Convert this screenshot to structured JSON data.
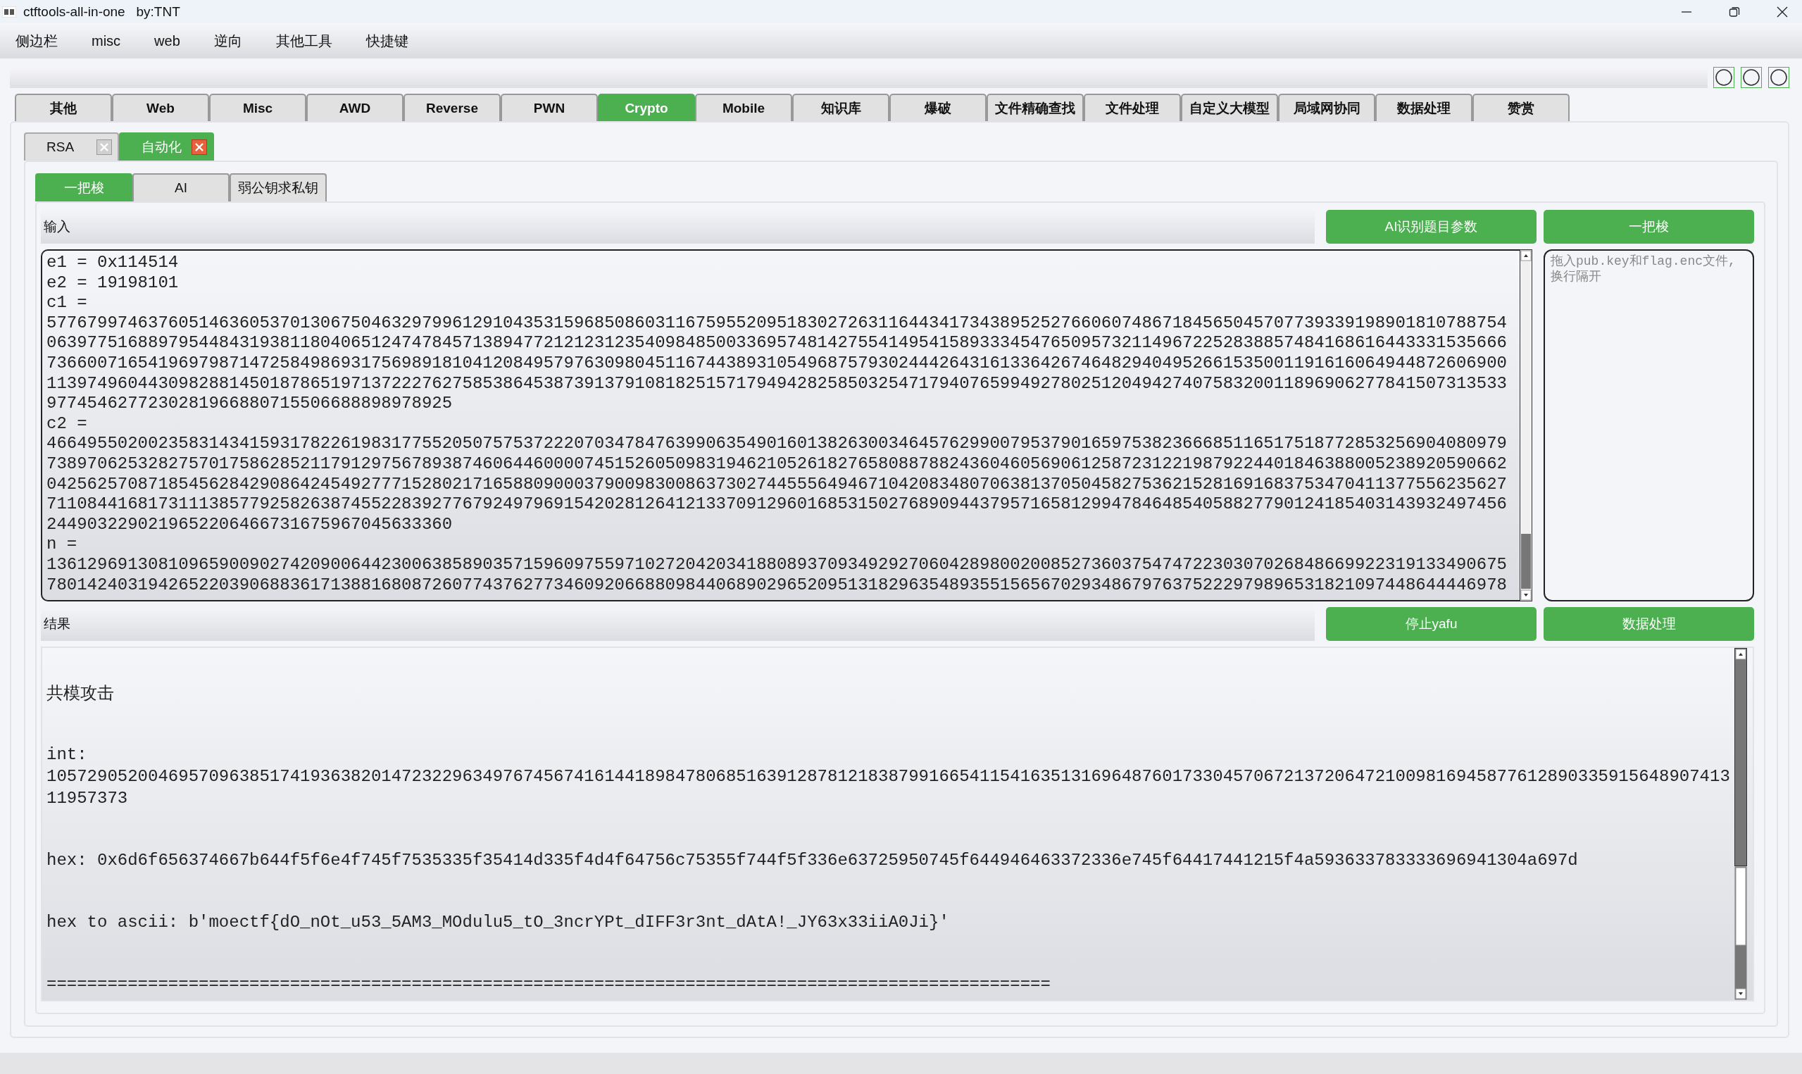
{
  "window": {
    "title": "ctftools-all-in-one   by:TNT"
  },
  "menu": [
    "侧边栏",
    "misc",
    "web",
    "逆向",
    "其他工具",
    "快捷键"
  ],
  "tabs": [
    {
      "label": "其他",
      "selected": false
    },
    {
      "label": "Web",
      "selected": false
    },
    {
      "label": "Misc",
      "selected": false
    },
    {
      "label": "AWD",
      "selected": false
    },
    {
      "label": "Reverse",
      "selected": false
    },
    {
      "label": "PWN",
      "selected": false
    },
    {
      "label": "Crypto",
      "selected": true
    },
    {
      "label": "Mobile",
      "selected": false
    },
    {
      "label": "知识库",
      "selected": false
    },
    {
      "label": "爆破",
      "selected": false
    },
    {
      "label": "文件精确查找",
      "selected": false
    },
    {
      "label": "文件处理",
      "selected": false
    },
    {
      "label": "自定义大模型",
      "selected": false
    },
    {
      "label": "局域网协同",
      "selected": false
    },
    {
      "label": "数据处理",
      "selected": false
    },
    {
      "label": "赞赏",
      "selected": false
    }
  ],
  "subtabs": [
    {
      "label": "RSA",
      "selected": false
    },
    {
      "label": "自动化",
      "selected": true
    }
  ],
  "modes": [
    {
      "label": "一把梭",
      "selected": true
    },
    {
      "label": "AI",
      "selected": false
    },
    {
      "label": "弱公钥求私钥",
      "selected": false
    }
  ],
  "input": {
    "label": "输入",
    "buttons": [
      "AI识别题目参数",
      "一把梭"
    ],
    "lines": [
      "e1 = 0x114514",
      "e2 = 19198101",
      "c1 =",
      "5776799746376051463605370130675046329799612910435315968508603116759552095183027263116443417343895252766060748671845650457077393391989018107887540639775168897954484319381180406512474784571389477212123123540984850033695748142755414954158933345476509573211496722528388574841686164433315356667366007165419697987147258498693175698918104120849579763098045116744389310549687579302444264316133642674648294049526615350011916160649448726069001139749604430982881450187865197137222762758538645387391379108182515717949428258503254717940765994927802512049427407583200118969062778415073135339774546277230281966880715506688898978925",
      "c2 =",
      "4664955020023583143415931782261983177552050757537222070347847639906354901601382630034645762990079537901659753823666851165175187728532569040809797389706253282757017586285211791297567893874606446000074515260509831946210526182765808878824360460569061258723122198792244018463880052389205906620425625708718545628429086424549277715280217165880900037900983008637302744555649467104208348070638137050458275362152816916837534704113775562356277110844168173111385779258263874552283927767924979691542028126412133709129601685315027689094437957165812994784648540588277901241854031439324974562449032290219652206466731675967045633360",
      "n =",
      "136129691308109659009027420900644230063858903571596097559710272042034188089370934929270604289800200852736037547472230307026848669922319133490675780142403194265220390688361713881680872607743762773460920668809844068902965209513182963548935515656702934867976375222979896531821097448644446978"
    ],
    "side_placeholder": "拖入pub.key和flag.enc文件,换行隔开"
  },
  "result": {
    "label": "结果",
    "buttons": [
      "停止yafu",
      "数据处理"
    ],
    "blocks": [
      {
        "kind": "title",
        "text": "共模攻击"
      },
      {
        "kind": "value",
        "label": "int:",
        "text": "105729052004695709638517419363820147232296349767456741614418984780685163912878121838799166541154163513169648760173304570672137206472100981694587761289033591564890741311957373"
      },
      {
        "kind": "inline",
        "text": "hex: 0x6d6f656374667b644f5f6e4f745f7535335f35414d335f4d4f64756c75355f744f5f336e63725950745f644946463372336e745f64417441215f4a593633783333696941304a697d"
      },
      {
        "kind": "inline",
        "text": "hex to ascii: b'moectf{dO_nOt_u53_5AM3_MOdulu5_tO_3ncrYPt_dIFF3r3nt_dAtA!_JY63x33iiA0Ji}'"
      },
      {
        "kind": "rule",
        "text": "==================================================================================================="
      }
    ]
  }
}
